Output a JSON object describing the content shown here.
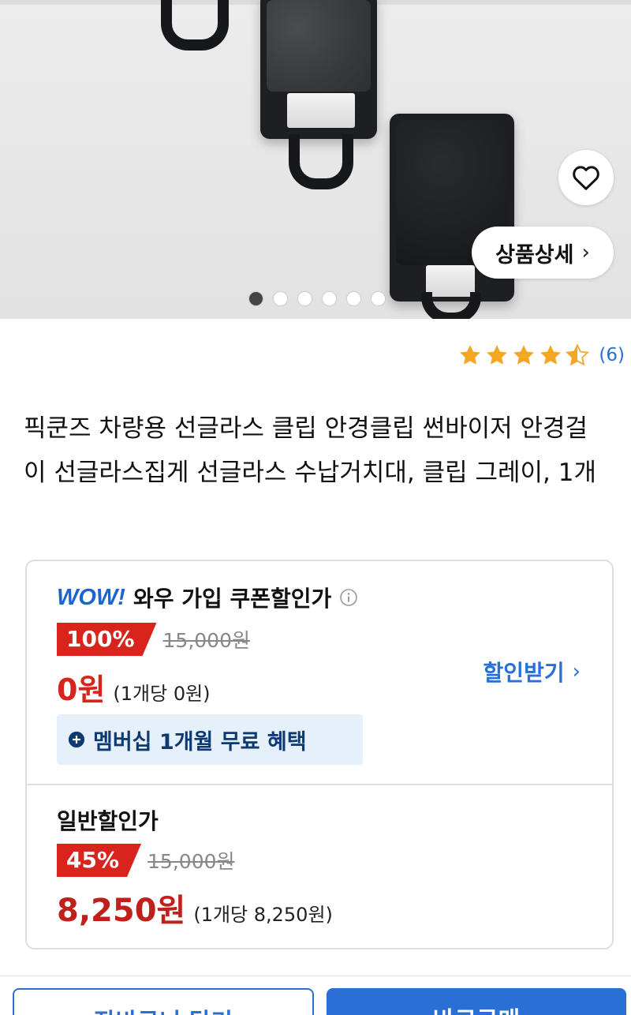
{
  "hero": {
    "detail_button_label": "상품상세",
    "detail_button_chevron": "›",
    "wishlist_icon": "heart-outline-icon",
    "carousel_total": 6,
    "carousel_active": 1
  },
  "rating": {
    "stars": 4.5,
    "max": 5,
    "review_count": "(6)",
    "star_color": "#f5a623"
  },
  "product": {
    "title": "픽쿤즈 차량용 선글라스 클립 안경클립 썬바이저 안경걸이 선글라스집게 선글라스 수납거치대, 클립 그레이, 1개"
  },
  "wow": {
    "logo": "WOW!",
    "label": "와우 가입 쿠폰할인가",
    "discount_badge": "100%",
    "original_price": "15,000원",
    "price": "0원",
    "unit_price": "(1개당 0원)",
    "coupon_link": "할인받기",
    "coupon_chevron": "›",
    "membership_benefit": "멤버십 1개월 무료 혜택"
  },
  "normal": {
    "label": "일반할인가",
    "discount_badge": "45%",
    "original_price": "15,000원",
    "price": "8,250원",
    "unit_price": "(1개당 8,250원)"
  },
  "actions": {
    "cart_label": "장바구니 담기",
    "buy_label": "바로구매"
  },
  "colors": {
    "accent_blue": "#2a6fd6",
    "discount_red": "#d9231d",
    "membership_bg": "#e6f0fb"
  }
}
